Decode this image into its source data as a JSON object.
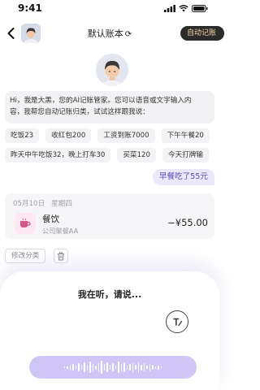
{
  "status_bar": {
    "time": "9:41"
  },
  "nav": {
    "title": "默认账本",
    "refresh_glyph": "⟳",
    "auto_button": "自动记账"
  },
  "intro": {
    "line1": "Hi，我是大黑，您的AI记账管家。您可以语音或文字输入内",
    "line2": "容，我帮您自动记账归类，试试这样跟我说："
  },
  "suggestions_row1": [
    "吃饭23",
    "收红包200",
    "工资到账7000",
    "下午午餐20"
  ],
  "suggestions_row2": [
    "昨天中午吃饭32，晚上打车30",
    "买菜120",
    "今天打牌输"
  ],
  "user_message": "早餐吃了55元",
  "record": {
    "date": "05月10日",
    "weekday": "星期四",
    "category": "餐饮",
    "note": "公司聚餐AA",
    "amount": "−¥55.00",
    "category_icon": "coffee-cup-icon",
    "icon_color": "#d4578a"
  },
  "actions": {
    "edit_category": "修改分类",
    "delete_icon": "trash-icon"
  },
  "voice": {
    "prompt": "我在听，请说...",
    "keyboard_icon": "keyboard-toggle-icon",
    "bar_color": "#cfc5f7"
  }
}
